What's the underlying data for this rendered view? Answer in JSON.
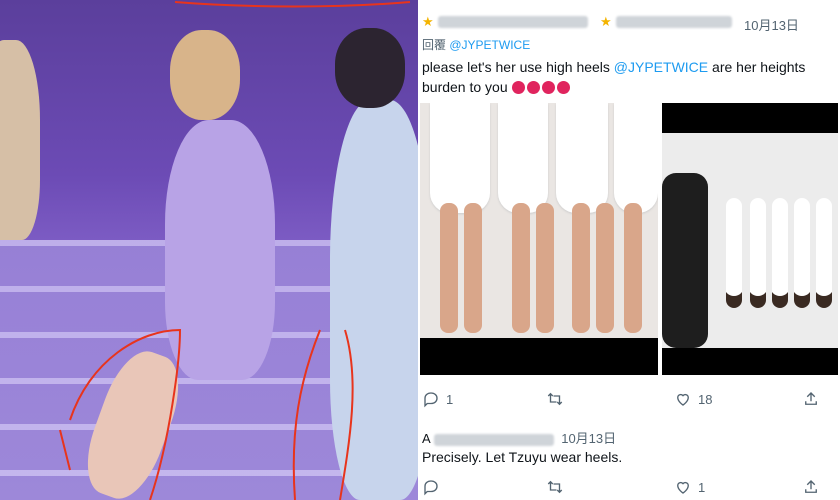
{
  "tweet": {
    "date": "10月13日",
    "reply_prefix": "回覆",
    "reply_handle": "@JYPETWICE",
    "text_part1": "please let's her use high heels ",
    "text_mention": "@JYPETWICE",
    "text_part2": " are her heights burden to you",
    "emoji_count": 4,
    "actions": {
      "replies": "1",
      "retweets": "",
      "likes": "18"
    }
  },
  "reply": {
    "author_initial": "A",
    "date": "10月13日",
    "text": "Precisely. Let Tzuyu wear heels.",
    "actions": {
      "replies": "",
      "retweets": "",
      "likes": "1"
    }
  },
  "colors": {
    "accent": "#1d9bf0",
    "muted": "#536471",
    "annotation_red": "#e8341c"
  }
}
